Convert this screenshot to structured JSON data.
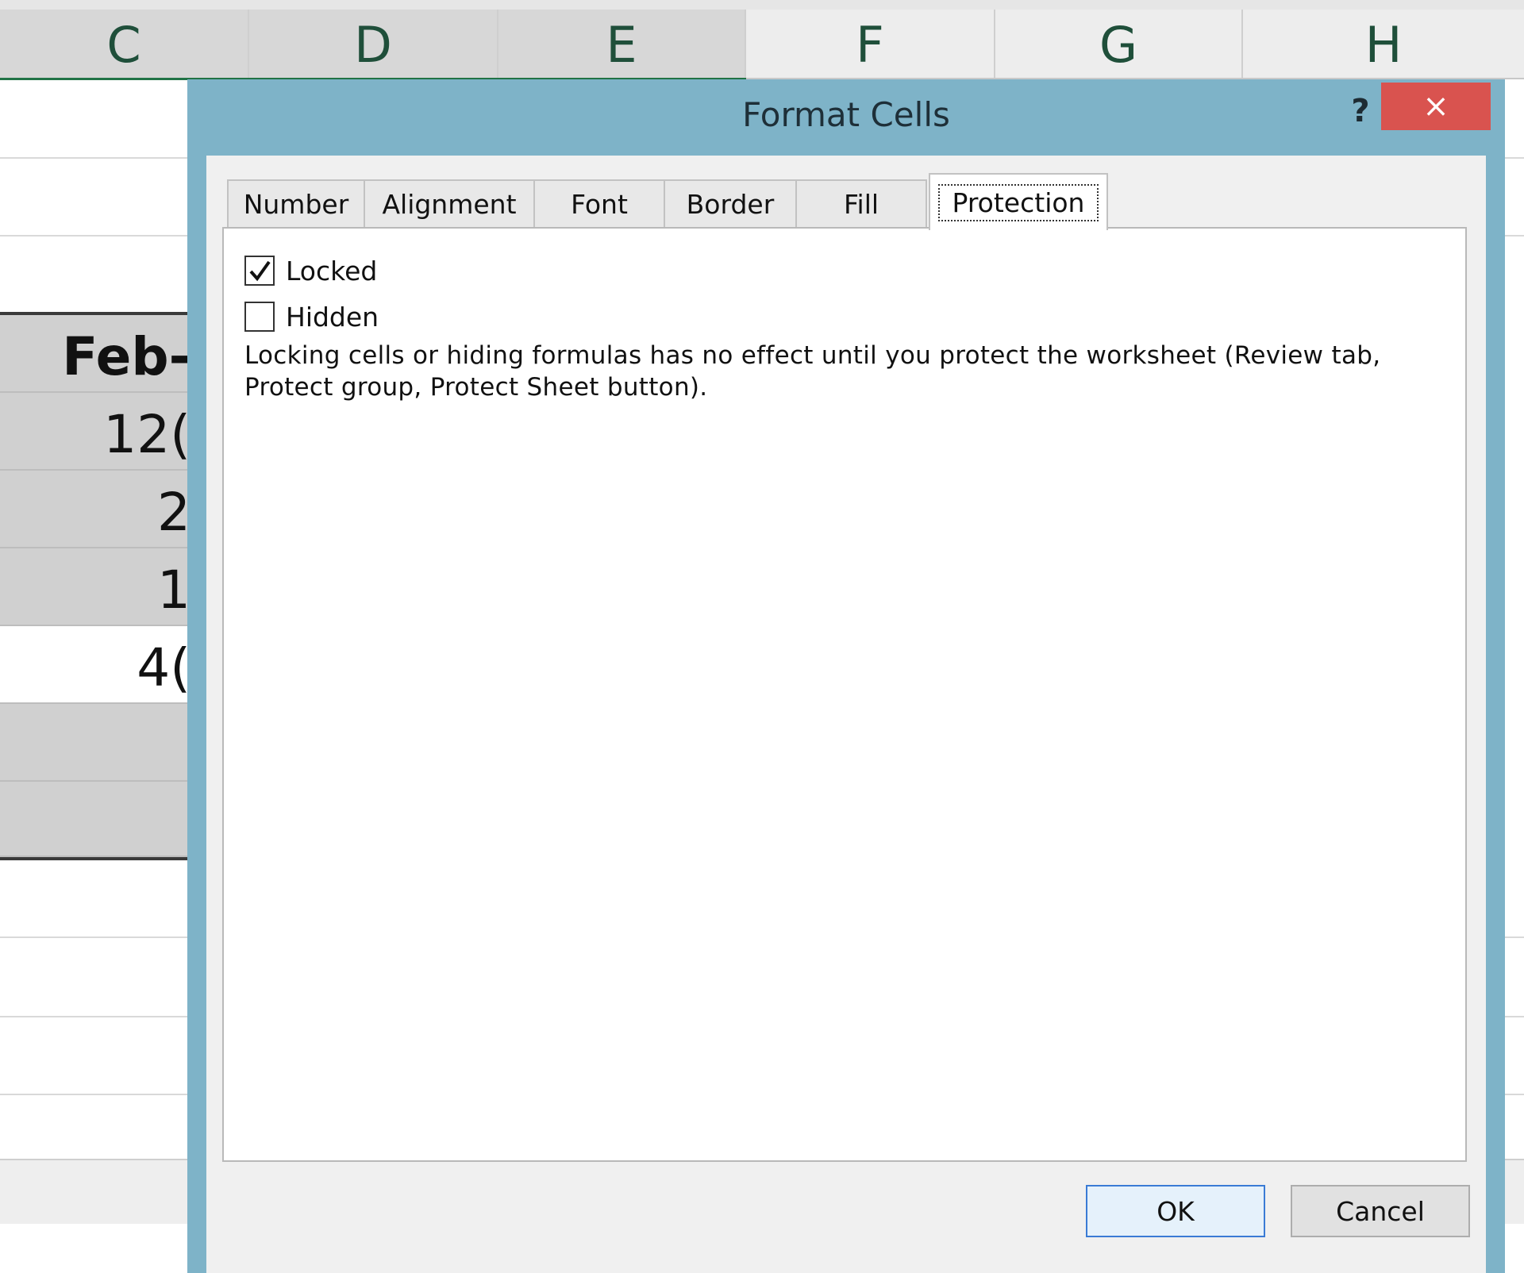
{
  "sheet": {
    "columns": [
      "C",
      "D",
      "E",
      "F",
      "G",
      "H"
    ],
    "cells": [
      "Feb-",
      "12(",
      "2",
      "1",
      "4("
    ]
  },
  "dialog": {
    "title": "Format Cells",
    "help": "?",
    "close": "×",
    "tabs": [
      "Number",
      "Alignment",
      "Font",
      "Border",
      "Fill",
      "Protection"
    ],
    "active_tab": "Protection",
    "protection": {
      "locked_label": "Locked",
      "locked_checked": true,
      "hidden_label": "Hidden",
      "hidden_checked": false,
      "note": "Locking cells or hiding formulas has no effect until you protect the worksheet (Review tab, Protect group, Protect Sheet button)."
    },
    "buttons": {
      "ok": "OK",
      "cancel": "Cancel"
    }
  },
  "colors": {
    "dialog_frame": "#7eb3c8",
    "close_red": "#d9534f",
    "ok_border": "#3a7bd5"
  },
  "icons": {
    "help": "question-icon",
    "close": "close-icon",
    "check": "checkmark-icon"
  }
}
